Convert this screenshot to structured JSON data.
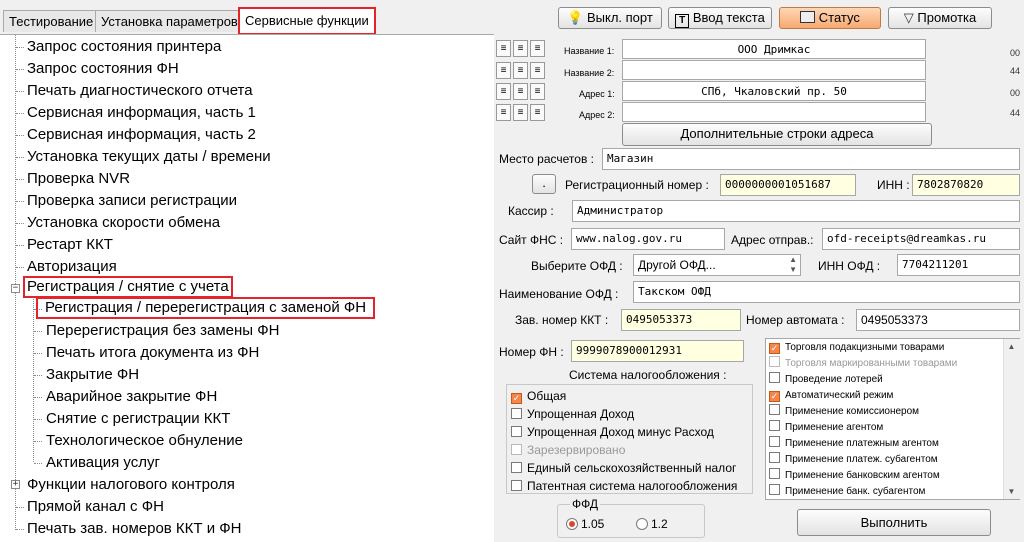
{
  "tabs": [
    "Тестирование",
    "Установка параметров",
    "Сервисные функции"
  ],
  "toolbar": {
    "port_label": "Выкл. порт",
    "text_label": "Ввод текста",
    "status_label": "Статус",
    "scroll_label": "Промотка"
  },
  "tree": {
    "items": [
      "Запрос состояния принтера",
      "Запрос состояния ФН",
      "Печать диагностического отчета",
      "Сервисная информация, часть 1",
      "Сервисная информация, часть 2",
      "Установка текущих даты / времени",
      "Проверка NVR",
      "Проверка записи регистрации",
      "Установка скорости обмена",
      "Рестарт ККТ",
      "Авторизация",
      "Регистрация / снятие с учета"
    ],
    "sub_items": [
      "Регистрация / перерегистрация с заменой ФН",
      "Перерегистрация без замены ФН",
      "Печать итога документа из ФН",
      "Закрытие ФН",
      "Аварийное закрытие ФН",
      "Снятие с регистрации ККТ",
      "Технологическое обнуление",
      "Активация услуг"
    ],
    "items_after": [
      "Функции налогового контроля",
      "Прямой канал с ФН",
      "Печать зав. номеров ККТ и ФН"
    ]
  },
  "form": {
    "name1_label": "Название 1:",
    "name1_value": "ООО Дримкас",
    "name1_side": "00",
    "name2_label": "Название 2:",
    "name2_value": "",
    "name2_side": "44",
    "addr1_label": "Адрес 1:",
    "addr1_value": "СПб, Чкаловский пр. 50",
    "addr1_side": "00",
    "addr2_label": "Адрес 2:",
    "addr2_value": "",
    "addr2_side": "44",
    "more_addr_button": "Дополнительные строки адреса",
    "place_label": "Место расчетов :",
    "place_value": "Магазин",
    "dot_button": ".",
    "reg_num_label": "Регистрационный номер :",
    "reg_num_value": "0000000001051687",
    "inn_label": "ИНН :",
    "inn_value": "7802870820",
    "cashier_label": "Кассир :",
    "cashier_value": "Администратор",
    "fns_label": "Сайт ФНС :",
    "fns_value": "www.nalog.gov.ru",
    "sender_label": "Адрес отправ.:",
    "sender_value": "ofd-receipts@dreamkas.ru",
    "ofd_select_label": "Выберите ОФД :",
    "ofd_select_value": "Другой ОФД...",
    "ofd_inn_label": "ИНН ОФД :",
    "ofd_inn_value": "7704211201",
    "ofd_name_label": "Наименование ОФД :",
    "ofd_name_value": "Такском ОФД",
    "kkt_num_label": "Зав. номер ККТ :",
    "kkt_num_value": "0495053373",
    "auto_num_label": "Номер автомата :",
    "auto_num_value": "0495053373",
    "fn_num_label": "Номер ФН :",
    "fn_num_value": "9999078900012931"
  },
  "tax": {
    "title": "Система налогообложения :",
    "options": [
      {
        "label": "Общая",
        "checked": true,
        "disabled": false
      },
      {
        "label": "Упрощенная Доход",
        "checked": false,
        "disabled": false
      },
      {
        "label": "Упрощенная Доход минус Расход",
        "checked": false,
        "disabled": false
      },
      {
        "label": "Зарезервировано",
        "checked": false,
        "disabled": true
      },
      {
        "label": "Единый сельскохозяйственный налог",
        "checked": false,
        "disabled": false
      },
      {
        "label": "Патентная система налогообложения",
        "checked": false,
        "disabled": false
      }
    ]
  },
  "modes": [
    {
      "label": "Торговля подакцизными товарами",
      "checked": true,
      "disabled": false
    },
    {
      "label": "Торговля маркированными товарами",
      "checked": false,
      "disabled": true
    },
    {
      "label": "Проведение лотерей",
      "checked": false,
      "disabled": false
    },
    {
      "label": "Автоматический режим",
      "checked": true,
      "disabled": false
    },
    {
      "label": "Применение комиссионером",
      "checked": false,
      "disabled": false
    },
    {
      "label": "Применение агентом",
      "checked": false,
      "disabled": false
    },
    {
      "label": "Применение платежным агентом",
      "checked": false,
      "disabled": false
    },
    {
      "label": "Применение платеж. субагентом",
      "checked": false,
      "disabled": false
    },
    {
      "label": "Применение банковским агентом",
      "checked": false,
      "disabled": false
    },
    {
      "label": "Применение банк. субагентом",
      "checked": false,
      "disabled": false
    }
  ],
  "ffd": {
    "title": "ФФД",
    "options": [
      {
        "label": "1.05",
        "selected": true
      },
      {
        "label": "1.2",
        "selected": false
      }
    ]
  },
  "execute_button": "Выполнить",
  "colors": {
    "highlight": "#e3242b",
    "checkbox_on": "#f5864a",
    "status_button": "#f7a870"
  }
}
